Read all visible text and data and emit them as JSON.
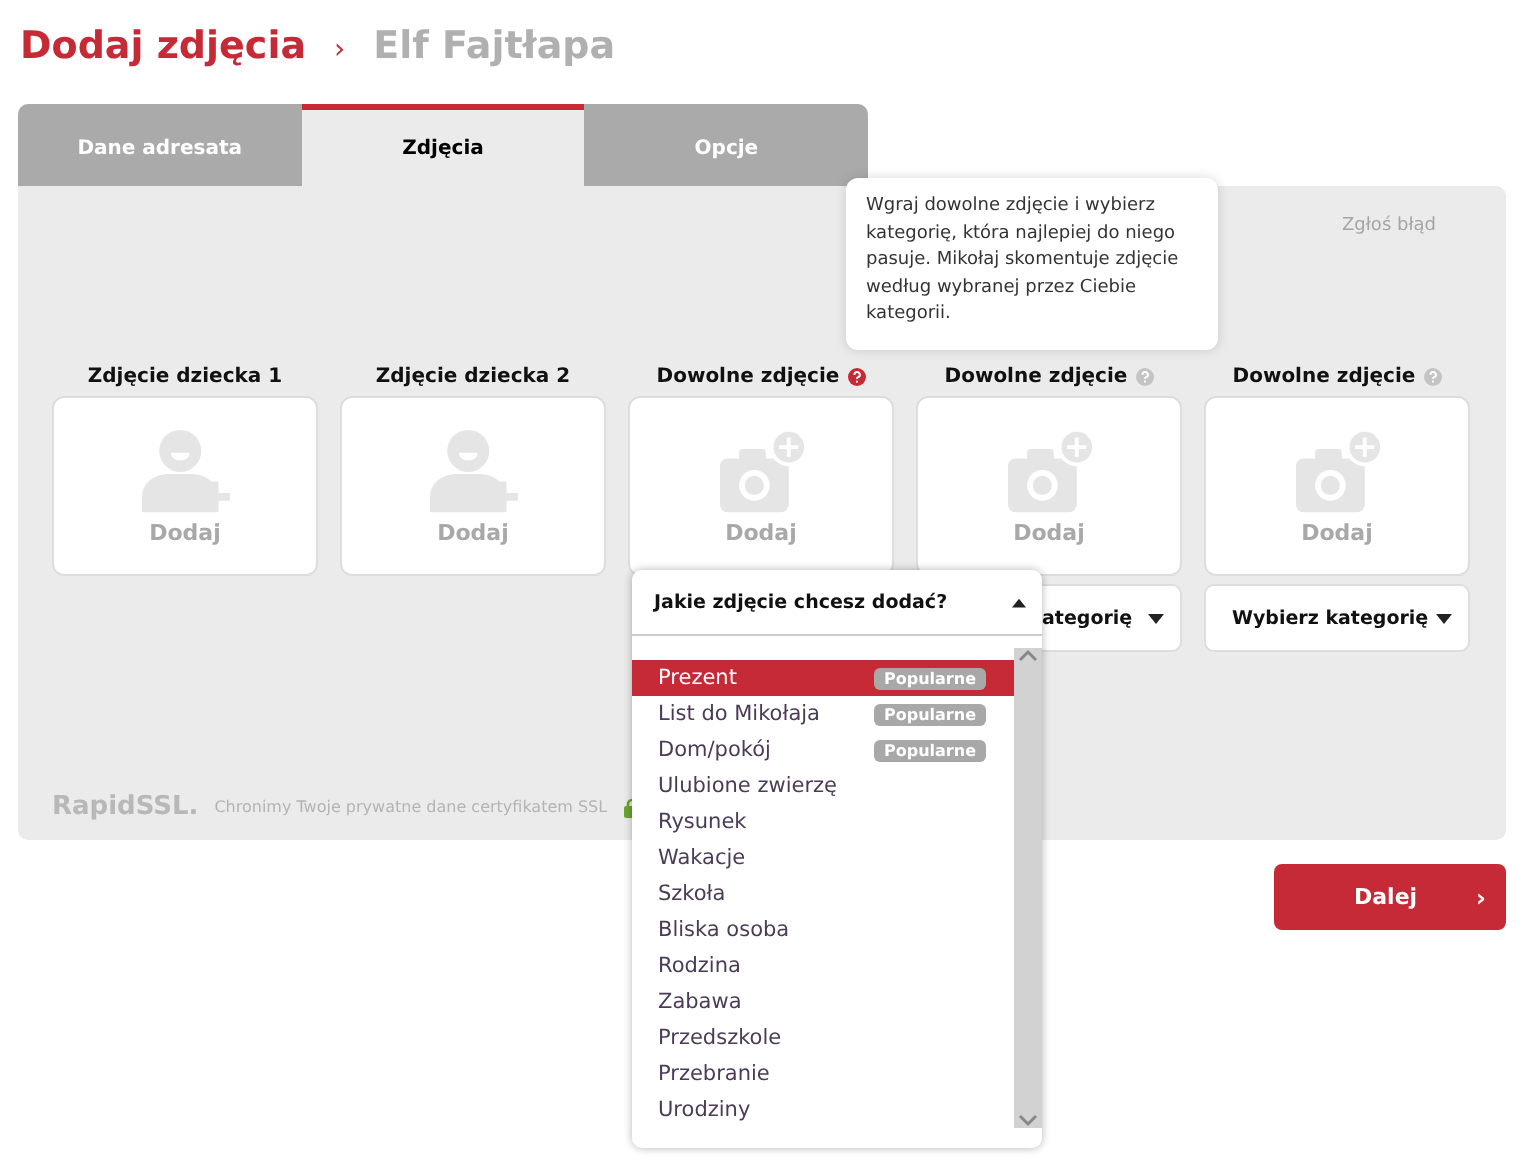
{
  "header": {
    "title": "Dodaj zdjęcia",
    "separator": "›",
    "subtitle": "Elf Fajtłapa"
  },
  "tabs": [
    {
      "label": "Dane adresata",
      "selected": false
    },
    {
      "label": "Zdjęcia",
      "selected": true
    },
    {
      "label": "Opcje",
      "selected": false
    }
  ],
  "report_link": "Zgłoś błąd",
  "slots": [
    {
      "label": "Zdjęcie dziecka 1",
      "kind": "person",
      "action": "Dodaj"
    },
    {
      "label": "Zdjęcie dziecka 2",
      "kind": "person",
      "action": "Dodaj"
    },
    {
      "label": "Dowolne zdjęcie",
      "kind": "camera",
      "action": "Dodaj",
      "help_active": true
    },
    {
      "label": "Dowolne zdjęcie",
      "kind": "camera",
      "action": "Dodaj",
      "help_active": false,
      "select": "ategorię",
      "select_clipped": true
    },
    {
      "label": "Dowolne zdjęcie",
      "kind": "camera",
      "action": "Dodaj",
      "help_active": false,
      "select": "Wybierz kategorię",
      "select_clipped": false
    }
  ],
  "footer": {
    "logo": "RapidSSL.",
    "note": "Chronimy Twoje prywatne dane certyfikatem SSL"
  },
  "next_button": {
    "label": "Dalej",
    "arrow": "›"
  },
  "tooltip": "Wgraj dowolne zdjęcie i wybierz kategorię, która najlepiej do niego pasuje. Mikołaj skomentuje zdjęcie według wybranej przez Ciebie kategorii.",
  "dropdown": {
    "prompt": "Jakie zdjęcie chcesz dodać?",
    "expanded": true,
    "options": [
      {
        "label": "Prezent",
        "selected": true,
        "badge": "Popularne"
      },
      {
        "label": "List do Mikołaja",
        "selected": false,
        "badge": "Popularne"
      },
      {
        "label": "Dom/pokój",
        "selected": false,
        "badge": "Popularne"
      },
      {
        "label": "Ulubione zwierzę",
        "selected": false
      },
      {
        "label": "Rysunek",
        "selected": false
      },
      {
        "label": "Wakacje",
        "selected": false
      },
      {
        "label": "Szkoła",
        "selected": false
      },
      {
        "label": "Bliska osoba",
        "selected": false
      },
      {
        "label": "Rodzina",
        "selected": false
      },
      {
        "label": "Zabawa",
        "selected": false
      },
      {
        "label": "Przedszkole",
        "selected": false
      },
      {
        "label": "Przebranie",
        "selected": false
      },
      {
        "label": "Urodziny",
        "selected": false
      }
    ]
  }
}
